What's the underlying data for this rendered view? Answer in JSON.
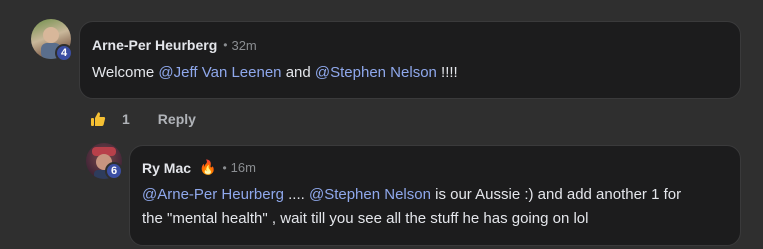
{
  "comments": [
    {
      "author": "Arne-Per Heurberg",
      "time": "32m",
      "badge": "4",
      "text": {
        "p1": "Welcome ",
        "m1": "@Jeff Van Leenen",
        "p2": " and ",
        "m2": "@Stephen Nelson",
        "p3": " !!!!"
      },
      "likes": "1",
      "reply_label": "Reply"
    },
    {
      "author": "Ry Mac",
      "emoji": "🔥",
      "time": "16m",
      "badge": "6",
      "text": {
        "m1": "@Arne-Per Heurberg",
        "p1": " .... ",
        "m2": "@Stephen Nelson",
        "p2": " is our Aussie :) and add another 1 for",
        "line2": "the \"mental health\" , wait till you see all the stuff he has going on lol"
      }
    }
  ],
  "colors": {
    "background": "#2f2f2f",
    "bubble": "#1c1c1d",
    "mention": "#8fa8ec",
    "badge": "#3b4ea3",
    "like": "#f5c033"
  },
  "icons": {
    "like": "thumbs-up-icon",
    "fire": "fire-emoji"
  }
}
